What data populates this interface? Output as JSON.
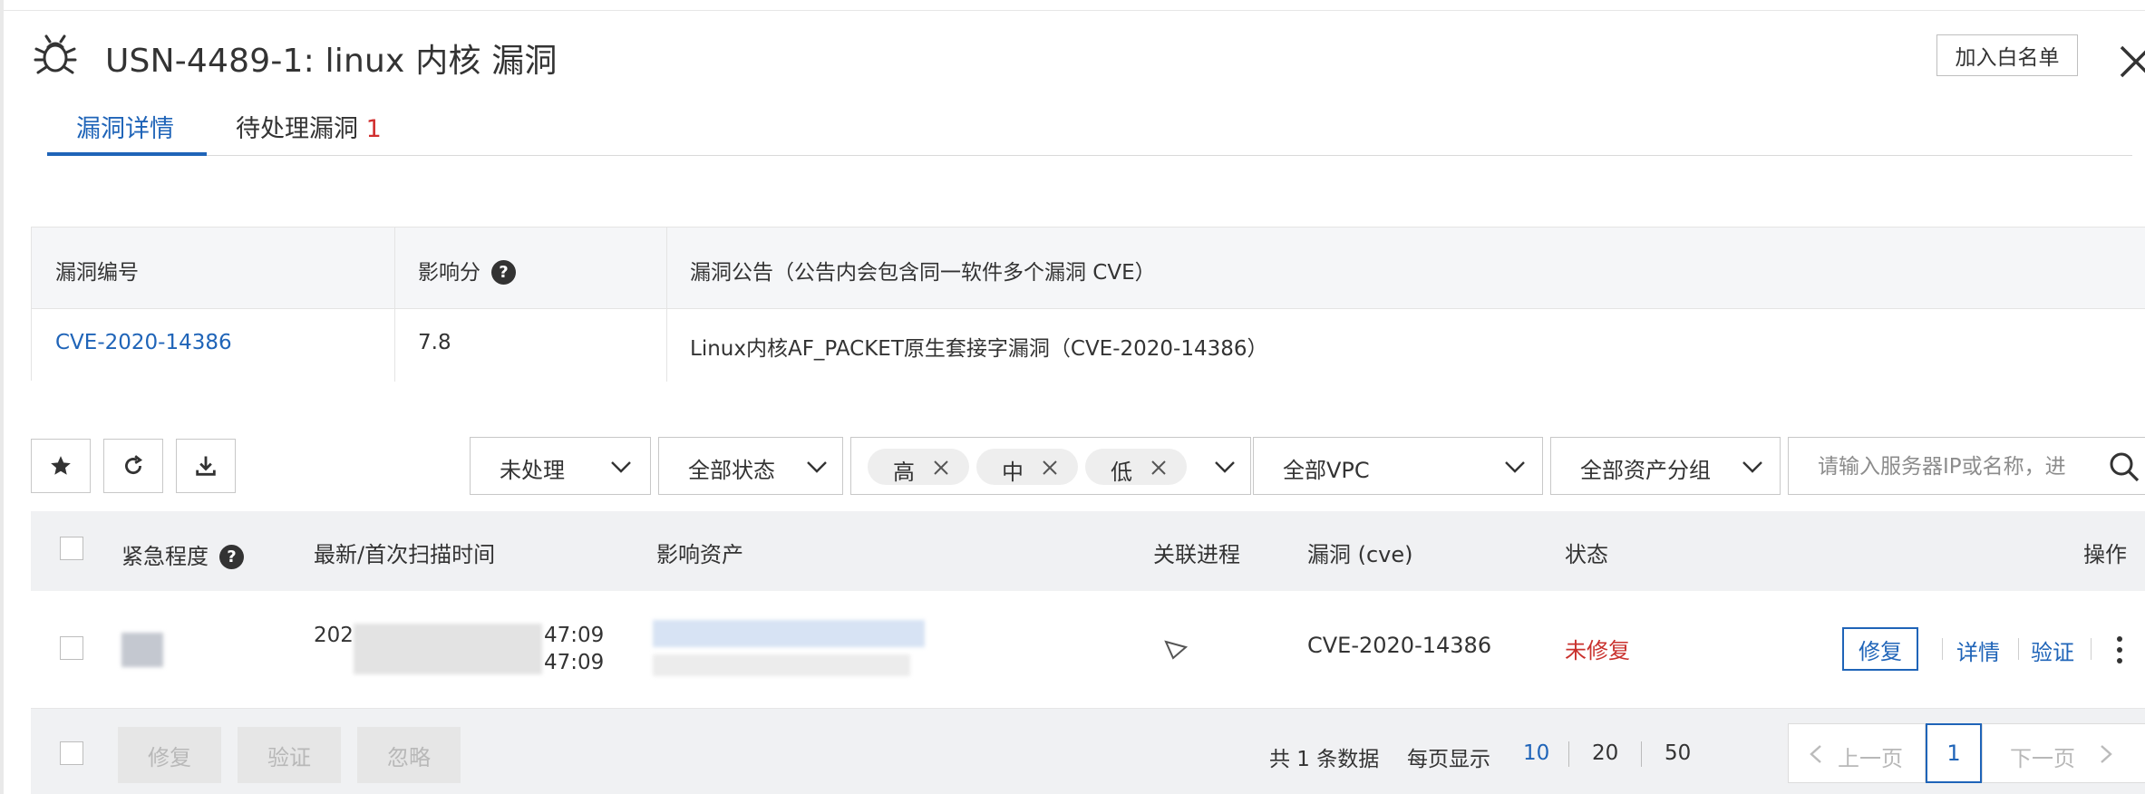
{
  "header": {
    "title": "USN-4489-1: linux 内核 漏洞",
    "whitelist_label": "加入白名单"
  },
  "tabs": [
    {
      "label": "漏洞详情"
    },
    {
      "label": "待处理漏洞",
      "count": "1"
    }
  ],
  "info": {
    "headers": [
      "漏洞编号",
      "影响分",
      "漏洞公告（公告内会包含同一软件多个漏洞 CVE）"
    ],
    "cve": "CVE-2020-14386",
    "score": "7.8",
    "notice": "Linux内核AF_PACKET原生套接字漏洞（CVE-2020-14386）"
  },
  "filters": {
    "process": "未处理",
    "status": "全部状态",
    "levels": [
      "高",
      "中",
      "低"
    ],
    "vpc": "全部VPC",
    "group": "全部资产分组",
    "search_placeholder": "请输入服务器IP或名称，进"
  },
  "table": {
    "columns": [
      "紧急程度",
      "最新/首次扫描时间",
      "影响资产",
      "关联进程",
      "漏洞 (cve)",
      "状态",
      "操作"
    ],
    "row": {
      "time_first": "202",
      "time_first_end": "47:09",
      "time_second_end": "47:09",
      "cve": "CVE-2020-14386",
      "status": "未修复",
      "actions": {
        "fix": "修复",
        "detail": "详情",
        "verify": "验证"
      }
    }
  },
  "footer": {
    "bulk": [
      "修复",
      "验证",
      "忽略"
    ],
    "total": "共 1 条数据",
    "per_page_label": "每页显示",
    "page_sizes": [
      "10",
      "20",
      "50"
    ],
    "prev": "上一页",
    "next": "下一页",
    "current_page": "1"
  },
  "colors": {
    "primary": "#1f64b8",
    "danger": "#c9302c"
  }
}
